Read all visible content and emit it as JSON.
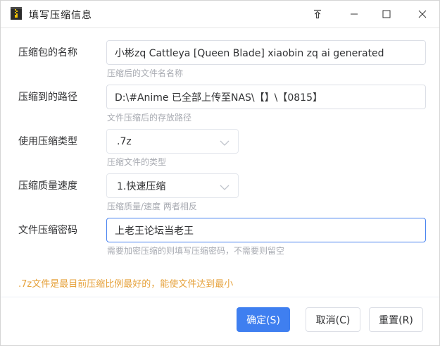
{
  "window": {
    "title": "填写压缩信息",
    "controls": {
      "pin": "pin-icon",
      "minimize": "minimize-icon",
      "maximize": "maximize-icon",
      "close": "close-icon"
    }
  },
  "form": {
    "archive_name": {
      "label": "压缩包的名称",
      "value": "小彬zq Cattleya [Queen Blade]  xiaobin zq ai generated",
      "hint": "压缩后的文件名名称"
    },
    "target_path": {
      "label": "压缩到的路径",
      "value": "D:\\#Anime 已全部上传至NAS\\【】\\【0815】",
      "hint": "文件压缩后的存放路径"
    },
    "compress_type": {
      "label": "使用压缩类型",
      "selected": ".7z",
      "hint": "压缩文件的类型"
    },
    "compress_speed": {
      "label": "压缩质量速度",
      "selected": "1.快速压缩",
      "hint": "压缩质量/速度 两者相反"
    },
    "password": {
      "label": "文件压缩密码",
      "value": "上老王论坛当老王",
      "hint": "需要加密压缩的则填写压缩密码，不需要则留空"
    }
  },
  "note": ".7z文件是最目前压缩比例最好的，能使文件达到最小",
  "buttons": {
    "confirm": "确定(S)",
    "cancel": "取消(C)",
    "reset": "重置(R)"
  },
  "colors": {
    "primary": "#3f7ff0",
    "note": "#e6a23c",
    "hint": "#a8abb2"
  }
}
